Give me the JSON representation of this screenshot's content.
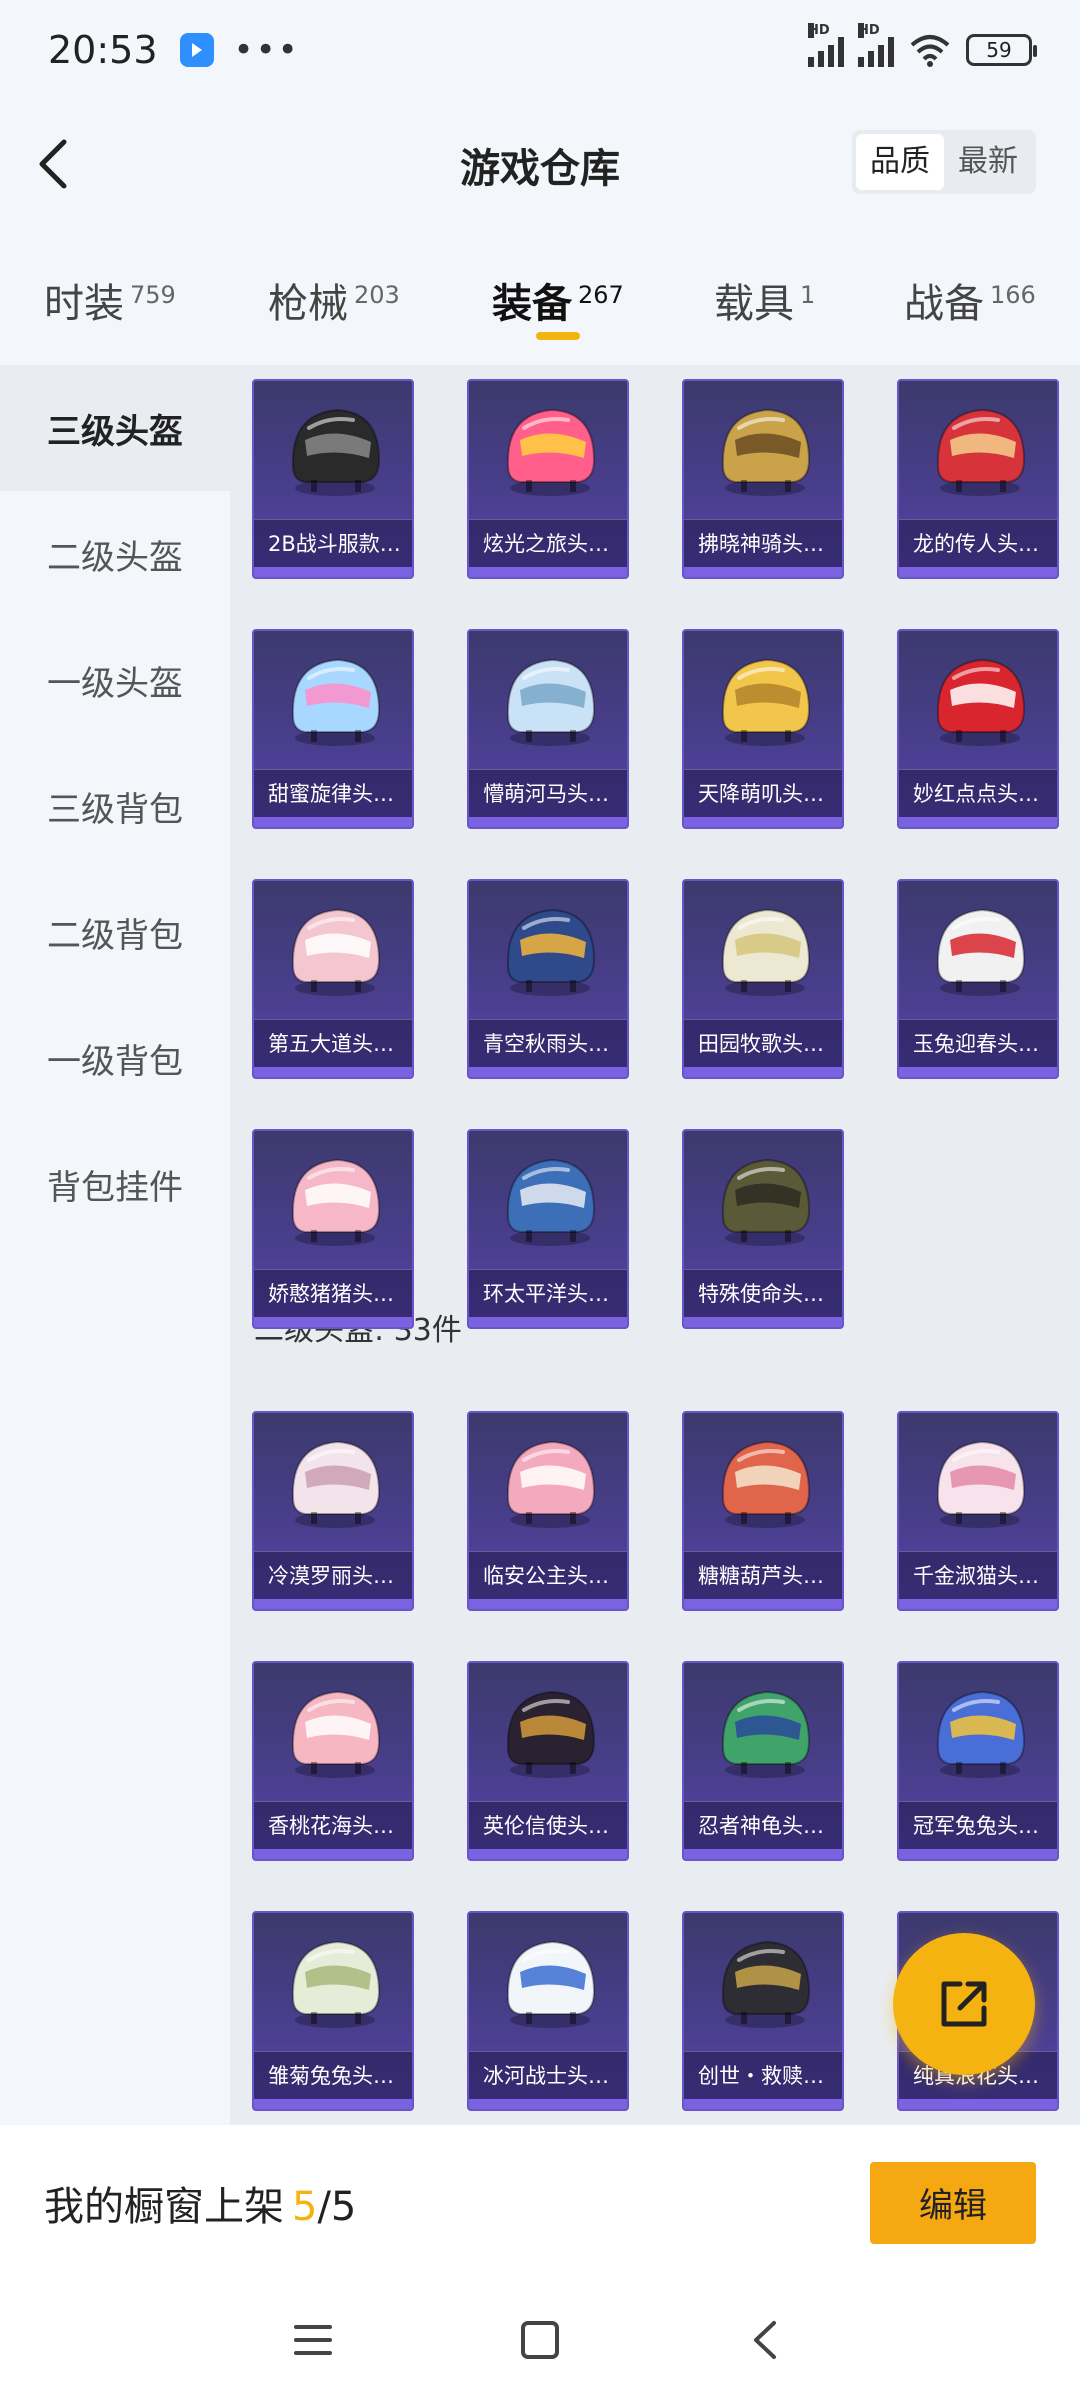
{
  "status_bar": {
    "time": "20:53",
    "more": "•••",
    "battery": "59",
    "hd1": "HD",
    "hd2": "HD"
  },
  "header": {
    "title": "游戏仓库",
    "sort_options": [
      "品质",
      "最新"
    ],
    "sort_active": "品质"
  },
  "tabs": [
    {
      "label": "时装",
      "count": "759"
    },
    {
      "label": "枪械",
      "count": "203"
    },
    {
      "label": "装备",
      "count": "267"
    },
    {
      "label": "载具",
      "count": "1"
    },
    {
      "label": "战备",
      "count": "166"
    }
  ],
  "sidebar": [
    "三级头盔",
    "二级头盔",
    "一级头盔",
    "三级背包",
    "二级背包",
    "一级背包",
    "背包挂件"
  ],
  "section2_title": "二级头盔: 33件",
  "items_level3": [
    {
      "name": "2B战斗服款…",
      "color": "#2a2a2a",
      "accent": "#888888"
    },
    {
      "name": "炫光之旅头…",
      "color": "#ff5f8a",
      "accent": "#ffd23c"
    },
    {
      "name": "拂晓神骑头…",
      "color": "#c9a24a",
      "accent": "#6b4c22"
    },
    {
      "name": "龙的传人头…",
      "color": "#d7333b",
      "accent": "#f4cf8c"
    },
    {
      "name": "甜蜜旋律头…",
      "color": "#a8d8ff",
      "accent": "#ff8ec9"
    },
    {
      "name": "懵萌河马头…",
      "color": "#c9e2f5",
      "accent": "#7aa7c9"
    },
    {
      "name": "天降萌叽头…",
      "color": "#f2c64a",
      "accent": "#b3842a"
    },
    {
      "name": "妙红点点头…",
      "color": "#d9262e",
      "accent": "#ffffff"
    },
    {
      "name": "第五大道头…",
      "color": "#f4c6cf",
      "accent": "#ffffff"
    },
    {
      "name": "青空秋雨头…",
      "color": "#2e4a8a",
      "accent": "#f2b53a"
    },
    {
      "name": "田园牧歌头…",
      "color": "#ece8d2",
      "accent": "#d4c67a"
    },
    {
      "name": "玉兔迎春头…",
      "color": "#f1f1f1",
      "accent": "#d8262e"
    },
    {
      "name": "娇憨猪猪头…",
      "color": "#f6b8c8",
      "accent": "#ffffff"
    },
    {
      "name": "环太平洋头…",
      "color": "#3d6fb8",
      "accent": "#e7ecf4"
    },
    {
      "name": "特殊使命头…",
      "color": "#5a5a38",
      "accent": "#2b2b22"
    }
  ],
  "items_level2": [
    {
      "name": "冷漠罗丽头…",
      "color": "#f3e4ec",
      "accent": "#c9a0b2"
    },
    {
      "name": "临安公主头…",
      "color": "#f3a9be",
      "accent": "#ffffff"
    },
    {
      "name": "糖糖葫芦头…",
      "color": "#e0654a",
      "accent": "#f3e6d0"
    },
    {
      "name": "千金淑猫头…",
      "color": "#f7e3ec",
      "accent": "#e58aa8"
    },
    {
      "name": "香桃花海头…",
      "color": "#f6b6c2",
      "accent": "#ffffff"
    },
    {
      "name": "英伦信使头…",
      "color": "#2a2230",
      "accent": "#d29a3a"
    },
    {
      "name": "忍者神龟头…",
      "color": "#3fa36a",
      "accent": "#2a4a9a"
    },
    {
      "name": "冠军兔兔头…",
      "color": "#4a6ed8",
      "accent": "#f2c43a"
    },
    {
      "name": "雏菊兔兔头…",
      "color": "#e7ecd9",
      "accent": "#a8b87a"
    },
    {
      "name": "冰河战士头…",
      "color": "#f2f6fb",
      "accent": "#3b6fd0"
    },
    {
      "name": "创世・救赎…",
      "color": "#2d2d33",
      "accent": "#c7a44a"
    },
    {
      "name": "纯真浪花头…",
      "color": "#f2f2f2",
      "accent": "#7ab7e8"
    }
  ],
  "bottom_bar": {
    "label": "我的橱窗上架",
    "count": "5",
    "total": "/5",
    "edit_label": "编辑"
  },
  "colors": {
    "accent": "#f5b312",
    "card_purple": "#4a3e8e"
  }
}
